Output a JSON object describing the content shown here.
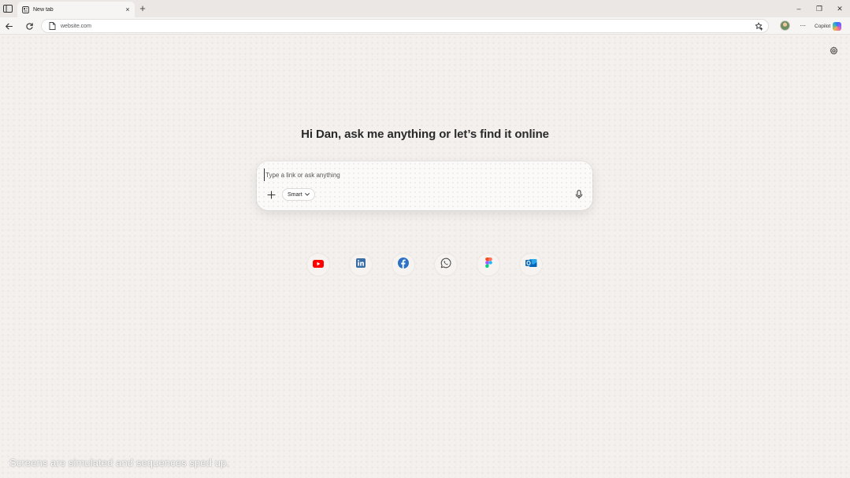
{
  "browser": {
    "tab": {
      "title": "New tab",
      "close_glyph": "×"
    },
    "new_tab_glyph": "+",
    "window_controls": {
      "minimize": "–",
      "restore": "❐",
      "close": "✕"
    },
    "address_bar": {
      "url": "website.com"
    },
    "more_glyph": "···",
    "copilot_label": "Copilot"
  },
  "page": {
    "greeting": "Hi Dan, ask me anything or let’s find it online",
    "search": {
      "placeholder": "Type a link or ask anything",
      "value": "",
      "add_glyph": "+",
      "mode_label": "Smart"
    },
    "quick_links": [
      {
        "name": "YouTube",
        "icon": "youtube-icon",
        "color": "#ff0000"
      },
      {
        "name": "LinkedIn",
        "icon": "linkedin-icon",
        "color": "#0a66c2"
      },
      {
        "name": "Facebook",
        "icon": "facebook-icon",
        "color": "#1877f2"
      },
      {
        "name": "WhatsApp",
        "icon": "whatsapp-icon",
        "color": "#4a4a4a"
      },
      {
        "name": "Figma",
        "icon": "figma-icon",
        "color": "#f24e1e"
      },
      {
        "name": "Outlook",
        "icon": "outlook-icon",
        "color": "#0f6cbd"
      }
    ],
    "disclaimer": "Screens are simulated and sequences sped up."
  },
  "colors": {
    "page_background": "#f3f0ee",
    "tabbar_background": "#ebe7e5",
    "text_primary": "#2a2a2a"
  }
}
